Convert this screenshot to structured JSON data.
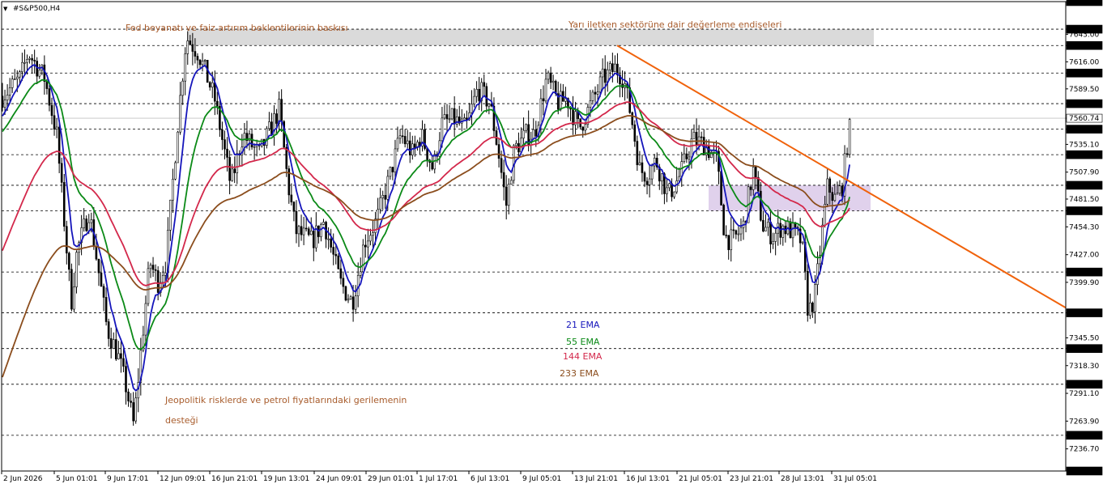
{
  "window": {
    "title": "#S&P500,H4",
    "menu_glyph": "▼"
  },
  "chart_data": {
    "type": "candlestick",
    "symbol": "#S&P500",
    "timeframe": "H4",
    "ylim": [
      7215,
      7675
    ],
    "y_ticks": [
      7675.0,
      7648.0,
      7643.0,
      7632.0,
      7616.0,
      7605.0,
      7589.5,
      7575.0,
      7560.74,
      7550.0,
      7535.1,
      7525.0,
      7507.9,
      7495.0,
      7481.5,
      7470.0,
      7454.3,
      7427.0,
      7410.0,
      7399.9,
      7370.0,
      7345.5,
      7335.0,
      7318.3,
      7300.0,
      7291.1,
      7263.9,
      7250.0,
      7236.7,
      7215.0
    ],
    "highlighted_levels": [
      7675.0,
      7648.0,
      7632.0,
      7605.0,
      7575.0,
      7560.74,
      7550.0,
      7525.0,
      7495.0,
      7470.0,
      7410.0,
      7370.0,
      7335.0,
      7300.0,
      7250.0,
      7215.0
    ],
    "current_price": 7560.74,
    "dashed_levels": [
      7648,
      7632,
      7605,
      7575,
      7550,
      7525,
      7495,
      7470,
      7410,
      7370,
      7335,
      7300,
      7250,
      7215
    ],
    "x_labels": [
      "2 Jun 2026",
      "5 Jun 01:01",
      "9 Jun 17:01",
      "12 Jun 09:01",
      "16 Jun 21:01",
      "19 Jun 13:01",
      "24 Jun 09:01",
      "29 Jun 01:01",
      "1 Jul 17:01",
      "6 Jul 13:01",
      "9 Jul 05:01",
      "13 Jul 21:01",
      "16 Jul 13:01",
      "21 Jul 05:01",
      "23 Jul 21:01",
      "28 Jul 13:01",
      "31 Jul 05:01"
    ],
    "anchors": [
      [
        0,
        7580
      ],
      [
        25,
        7600
      ],
      [
        35,
        7625
      ],
      [
        55,
        7600
      ],
      [
        70,
        7545
      ],
      [
        88,
        7380
      ],
      [
        95,
        7430
      ],
      [
        110,
        7470
      ],
      [
        120,
        7420
      ],
      [
        132,
        7355
      ],
      [
        145,
        7330
      ],
      [
        155,
        7300
      ],
      [
        165,
        7260
      ],
      [
        175,
        7340
      ],
      [
        185,
        7420
      ],
      [
        195,
        7400
      ],
      [
        205,
        7420
      ],
      [
        220,
        7560
      ],
      [
        230,
        7640
      ],
      [
        245,
        7625
      ],
      [
        265,
        7580
      ],
      [
        285,
        7495
      ],
      [
        300,
        7545
      ],
      [
        320,
        7525
      ],
      [
        345,
        7570
      ],
      [
        355,
        7500
      ],
      [
        365,
        7450
      ],
      [
        385,
        7440
      ],
      [
        400,
        7460
      ],
      [
        420,
        7400
      ],
      [
        435,
        7380
      ],
      [
        450,
        7440
      ],
      [
        465,
        7460
      ],
      [
        480,
        7500
      ],
      [
        495,
        7545
      ],
      [
        510,
        7525
      ],
      [
        520,
        7545
      ],
      [
        535,
        7510
      ],
      [
        545,
        7555
      ],
      [
        560,
        7560
      ],
      [
        575,
        7550
      ],
      [
        590,
        7590
      ],
      [
        605,
        7575
      ],
      [
        615,
        7530
      ],
      [
        625,
        7475
      ],
      [
        635,
        7530
      ],
      [
        650,
        7545
      ],
      [
        660,
        7545
      ],
      [
        675,
        7600
      ],
      [
        690,
        7575
      ],
      [
        700,
        7580
      ],
      [
        715,
        7550
      ],
      [
        730,
        7575
      ],
      [
        745,
        7600
      ],
      [
        760,
        7610
      ],
      [
        770,
        7600
      ],
      [
        780,
        7560
      ],
      [
        790,
        7510
      ],
      [
        800,
        7505
      ],
      [
        810,
        7520
      ],
      [
        825,
        7485
      ],
      [
        840,
        7505
      ],
      [
        855,
        7540
      ],
      [
        870,
        7535
      ],
      [
        885,
        7520
      ],
      [
        895,
        7445
      ],
      [
        905,
        7440
      ],
      [
        918,
        7455
      ],
      [
        930,
        7510
      ],
      [
        942,
        7455
      ],
      [
        955,
        7445
      ],
      [
        965,
        7455
      ],
      [
        978,
        7450
      ],
      [
        990,
        7440
      ],
      [
        998,
        7370
      ],
      [
        1006,
        7385
      ],
      [
        1014,
        7440
      ],
      [
        1022,
        7495
      ],
      [
        1032,
        7480
      ],
      [
        1040,
        7495
      ],
      [
        1046,
        7535
      ],
      [
        1051,
        7558
      ]
    ],
    "series": [
      {
        "name": "21 EMA",
        "color": "#1515bb",
        "period": 21
      },
      {
        "name": "55 EMA",
        "color": "#0b8a17",
        "period": 55
      },
      {
        "name": "144 EMA",
        "color": "#d3284b",
        "period": 144
      },
      {
        "name": "233 EMA",
        "color": "#8b4d1d",
        "period": 233
      }
    ],
    "legend": {
      "placement": "bottom-center",
      "labels": [
        "21 EMA",
        "55 EMA",
        "144 EMA",
        "233 EMA"
      ]
    },
    "zones": [
      {
        "name": "resistance",
        "y1": 7632,
        "y2": 7648,
        "color": "#d3d3d3"
      },
      {
        "name": "support",
        "y1": 7470,
        "y2": 7495,
        "color": "#ddccea"
      }
    ],
    "trendline": {
      "color": "#f0620b",
      "points": [
        [
          "13 Jul 21:01",
          7632
        ],
        [
          "31 Jul 05:01",
          7458
        ]
      ]
    },
    "annotations": [
      {
        "text": "Fed beyanatı ve faiz artırım beklentilerinin baskısı"
      },
      {
        "text": "Yarı iletken sektörüne dair değerleme endişeleri"
      },
      {
        "text": "Jeopolitik risklerde ve petrol fiyatlarındaki gerilemenin"
      },
      {
        "text": "desteği"
      }
    ],
    "grid": false
  }
}
